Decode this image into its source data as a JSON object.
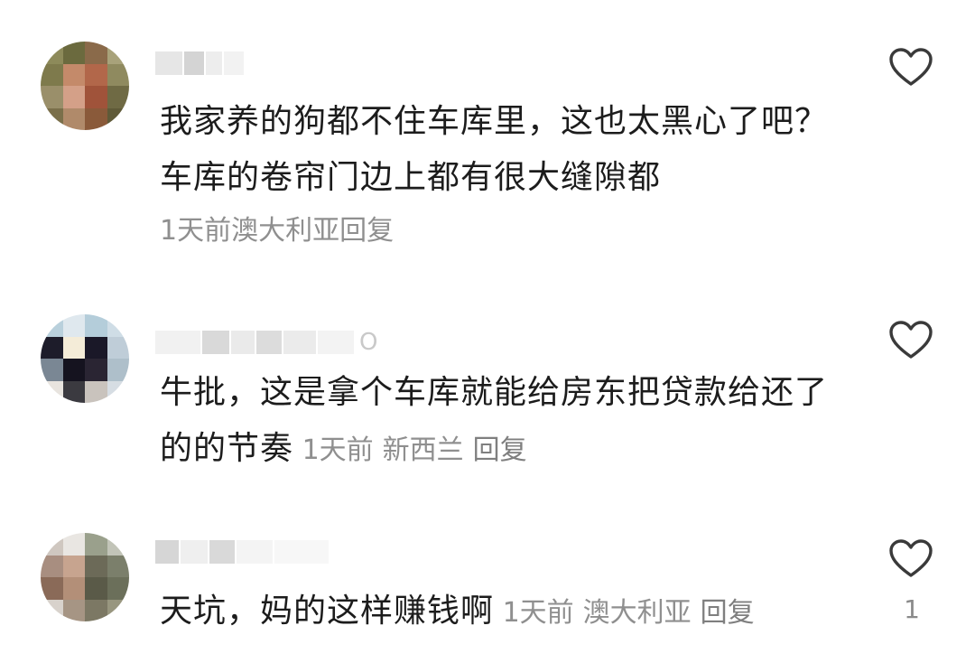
{
  "comments": [
    {
      "text": "我家养的狗都不住车库里，这也太黑心了吧？车库的卷帘门边上都有很大缝隙都",
      "time": "1天前",
      "location": "澳大利亚",
      "reply_label": "回复",
      "like_icon": "heart-outline-icon"
    },
    {
      "username_visible_fragment": "O",
      "text": "牛批，这是拿个车库就能给房东把贷款给还了的的节奏",
      "time": "1天前",
      "location": "新西兰",
      "reply_label": "回复",
      "like_icon": "heart-outline-icon"
    },
    {
      "text": "天坑，妈的这样赚钱啊",
      "time": "1天前",
      "location": "澳大利亚",
      "reply_label": "回复",
      "like_icon": "heart-outline-icon",
      "like_count": "1"
    }
  ],
  "colors": {
    "text": "#1c1c1c",
    "meta": "#8f8f8f",
    "icon": "#3a3a3a"
  }
}
